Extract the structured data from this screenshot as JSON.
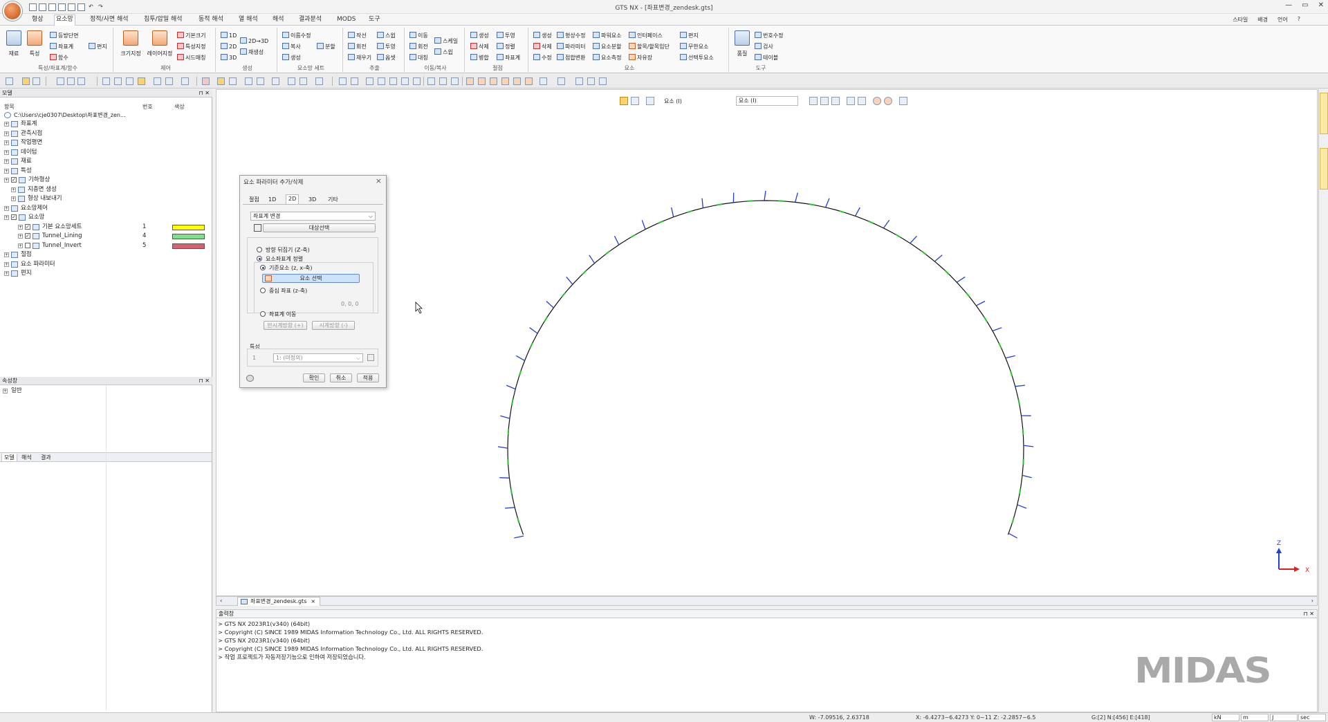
{
  "window": {
    "title": "GTS NX - [좌표변경_zendesk.gts]",
    "controls": [
      "—",
      "▭",
      "✕"
    ]
  },
  "menu": {
    "tabs": [
      "형상",
      "요소망",
      "정적/사면 해석",
      "침투/압밀 해석",
      "동적 해석",
      "열 해석",
      "해석",
      "결과분석",
      "MODS",
      "도구"
    ],
    "active_tab": 1,
    "right": [
      "스타일",
      "배경",
      "언어",
      "?"
    ]
  },
  "ribbon": {
    "groups": {
      "g1": {
        "label": "특성/좌표계/함수",
        "big1": "재료",
        "big2": "특성",
        "items": [
          "등방단면",
          "좌표계",
          "함수",
          "편지"
        ]
      },
      "g2": {
        "label": "제어",
        "big1": "크기지정",
        "big2": "레이어지정",
        "items": [
          "기본크기",
          "특성지정",
          "시드매칭"
        ]
      },
      "g3": {
        "label": "생성",
        "items": [
          "1D",
          "2D",
          "3D",
          "2D→3D",
          "재생성"
        ]
      },
      "g4": {
        "label": "요소망 세트",
        "items": [
          "이름수정",
          "복사",
          "생성",
          "분할"
        ]
      },
      "g5": {
        "label": "추출",
        "items": [
          "작선",
          "회전",
          "재우기",
          "스윕",
          "투영",
          "옵셋"
        ]
      },
      "g6": {
        "label": "이동/복사",
        "items": [
          "이동",
          "회전",
          "대칭",
          "스케일",
          "스윕"
        ]
      },
      "g7": {
        "label": "절점",
        "items": [
          "생성",
          "삭제",
          "병합",
          "투영",
          "정렬",
          "좌표계"
        ]
      },
      "g8": {
        "label": "요소",
        "items": [
          "생성",
          "삭제",
          "수정",
          "형상수정",
          "파라미터",
          "점합변환",
          "파워요소",
          "요소분할",
          "요소측정",
          "인터페이스",
          "할목/할목입단",
          "자유장",
          "편지",
          "무한요소",
          "선택투요소"
        ]
      },
      "g9": {
        "label": "도구",
        "big1": "품질",
        "items": [
          "번호수정",
          "검사",
          "테이블"
        ]
      }
    }
  },
  "model_panel": {
    "title": "모델",
    "columns": {
      "item": "항목",
      "number": "번호",
      "color": "색상"
    },
    "path": "C:\\Users\\cje0307\\Desktop\\좌표변경_zen...",
    "tree": [
      {
        "label": "좌표계",
        "indent": 1
      },
      {
        "label": "관측시점",
        "indent": 1
      },
      {
        "label": "작업평면",
        "indent": 1
      },
      {
        "label": "데이텀",
        "indent": 1
      },
      {
        "label": "재료",
        "indent": 1
      },
      {
        "label": "특성",
        "indent": 1
      },
      {
        "label": "기하형상",
        "indent": 1,
        "checked": true
      },
      {
        "label": "지층면 생성",
        "indent": 2
      },
      {
        "label": "형상 내보내기",
        "indent": 2
      },
      {
        "label": "요소망제어",
        "indent": 1
      },
      {
        "label": "요소망",
        "indent": 1,
        "checked": true
      },
      {
        "label": "기본 요소망세트",
        "indent": 3,
        "checked": true,
        "number": "1",
        "color": "#ffff00"
      },
      {
        "label": "Tunnel_Lining",
        "indent": 3,
        "checked": true,
        "number": "4",
        "color": "#7fe08a"
      },
      {
        "label": "Tunnel_Invert",
        "indent": 3,
        "checked": false,
        "number": "5",
        "color": "#d9606f"
      },
      {
        "label": "절점",
        "indent": 1
      },
      {
        "label": "요소 파라미터",
        "indent": 1
      },
      {
        "label": "편지",
        "indent": 1
      }
    ],
    "tabs": [
      "모델",
      "해석",
      "결과"
    ]
  },
  "property_panel": {
    "title": "속성창",
    "items": [
      "일반"
    ]
  },
  "viewport": {
    "toolbar": {
      "filter_label": "요소 (I)",
      "select_label": "요소 (I)"
    },
    "axis": {
      "z": "Z",
      "x": "X"
    }
  },
  "dialog": {
    "title": "요소 파라미터 추가/삭제",
    "tabs": [
      "절점",
      "1D",
      "2D",
      "3D",
      "기타"
    ],
    "active_tab": 2,
    "mode_select": "좌표계 변경",
    "target_button": "대상선택",
    "opt_flip": "방향 뒤집기 (Z-축)",
    "opt_align": "요소좌표계 정렬",
    "sub_ref": "기준요소 (z, x-축)",
    "select_element_button": "요소 선택",
    "sub_center": "중심 좌표 (z-축)",
    "center_value": "0, 0, 0",
    "opt_move": "좌표계 이동",
    "ccw_button": "반시계방향 (+)",
    "cw_button": "시계방향 (-)",
    "property_label": "특성",
    "property_id": "1",
    "property_value": "1: (미정의)",
    "ok": "확인",
    "cancel": "취소",
    "apply": "적용"
  },
  "doc_tab": "좌표변경_zendesk.gts",
  "output": {
    "title": "출력창",
    "lines": [
      "> GTS NX 2023R1(v340) (64bit)",
      "> Copyright (C) SINCE 1989 MIDAS Information Technology Co., Ltd. ALL RIGHTS RESERVED.",
      "> GTS NX 2023R1(v340) (64bit)",
      "> Copyright (C) SINCE 1989 MIDAS Information Technology Co., Ltd. ALL RIGHTS RESERVED.",
      "> 작업 프로젝트가 자동저장기능으로 인하여 저장되었습니다."
    ]
  },
  "logo": "MIDAS",
  "status": {
    "w": "W: -7.09516, 2.63718",
    "xyz": "X: -6.4273~6.4273 Y: 0~11 Z: -2.2857~6.5",
    "counts": "G:[2] N:[456] E:[418]",
    "units": [
      "kN",
      "m",
      "J",
      "sec"
    ]
  },
  "colors": {
    "lining_line": "#111111",
    "node_marker": "#22c322",
    "axis_arrow": "#1f3fd6",
    "x_axis": "#e02020",
    "z_axis": "#1f3fd6"
  }
}
